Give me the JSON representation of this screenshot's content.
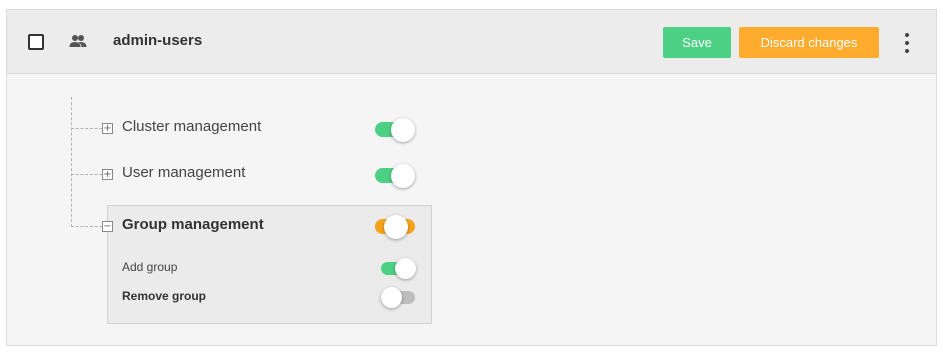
{
  "header": {
    "role_name": "admin-users",
    "save_label": "Save",
    "discard_label": "Discard changes"
  },
  "permissions": [
    {
      "label": "Cluster management",
      "expander": "+",
      "enabled": true
    },
    {
      "label": "User management",
      "expander": "+",
      "enabled": true
    },
    {
      "label": "Group management",
      "expander": "−",
      "enabled": "partial",
      "children": [
        {
          "label": "Add group",
          "enabled": true
        },
        {
          "label": "Remove group",
          "enabled": false
        }
      ]
    }
  ],
  "colors": {
    "save": "#4cd083",
    "discard": "#ffab2e",
    "toggle_on": "#4cd083",
    "toggle_partial": "#f5a31a",
    "toggle_off": "#bdbdbd"
  }
}
